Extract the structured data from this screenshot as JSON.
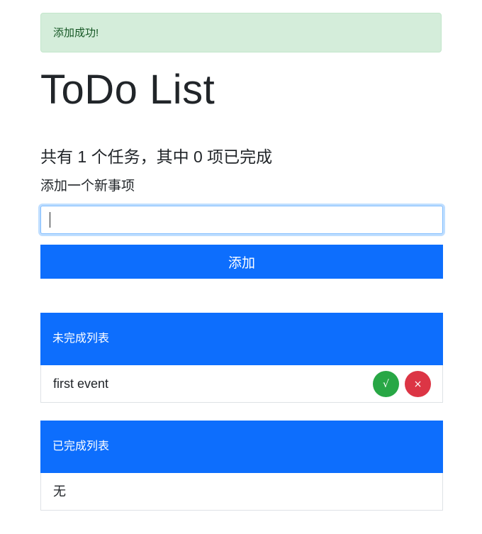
{
  "alert": {
    "message": "添加成功!"
  },
  "header": {
    "title": "ToDo List"
  },
  "summary": {
    "text": "共有 1 个任务，其中 0 项已完成"
  },
  "add_form": {
    "label": "添加一个新事项",
    "input_value": "",
    "placeholder": "",
    "button_label": "添加"
  },
  "incomplete": {
    "title": "未完成列表",
    "items": [
      {
        "text": "first event",
        "done_label": "√",
        "delete_label": "×"
      }
    ]
  },
  "completed": {
    "title": "已完成列表",
    "empty_text": "无"
  },
  "colors": {
    "primary": "#0d6efd",
    "success": "#28a745",
    "danger": "#dc3545",
    "alert_bg": "#d4edda",
    "alert_text": "#155724"
  }
}
